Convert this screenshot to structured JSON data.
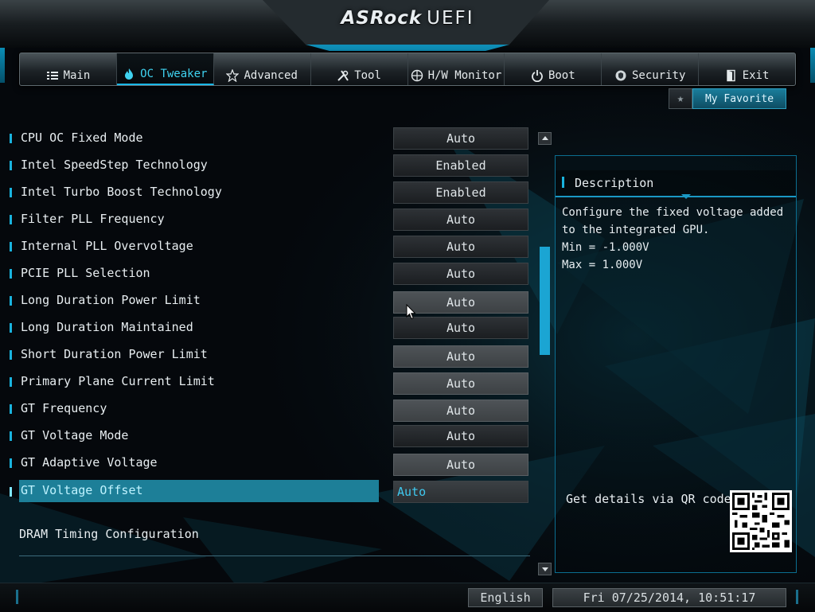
{
  "header": {
    "brand": "ASRock",
    "product": "UEFI"
  },
  "tabs": [
    {
      "label": "Main",
      "icon": "list-icon"
    },
    {
      "label": "OC Tweaker",
      "icon": "flame-icon",
      "active": true
    },
    {
      "label": "Advanced",
      "icon": "star-icon"
    },
    {
      "label": "Tool",
      "icon": "tools-icon"
    },
    {
      "label": "H/W Monitor",
      "icon": "monitor-icon"
    },
    {
      "label": "Boot",
      "icon": "power-icon"
    },
    {
      "label": "Security",
      "icon": "shield-icon"
    },
    {
      "label": "Exit",
      "icon": "exit-door-icon"
    }
  ],
  "favorite": {
    "label": "My Favorite",
    "star": "★"
  },
  "settings": [
    {
      "label": "CPU OC Fixed Mode",
      "value": "Auto"
    },
    {
      "label": "Intel SpeedStep Technology",
      "value": "Enabled"
    },
    {
      "label": "Intel Turbo Boost Technology",
      "value": "Enabled"
    },
    {
      "label": "Filter PLL Frequency",
      "value": "Auto"
    },
    {
      "label": "Internal PLL Overvoltage",
      "value": "Auto"
    },
    {
      "label": "PCIE PLL Selection",
      "value": "Auto"
    },
    {
      "label": "Long Duration Power Limit",
      "value": "Auto"
    },
    {
      "label": "Long Duration Maintained",
      "value": "Auto"
    },
    {
      "label": "Short Duration Power Limit",
      "value": "Auto"
    },
    {
      "label": "Primary Plane Current Limit",
      "value": "Auto"
    },
    {
      "label": "GT Frequency",
      "value": "Auto"
    },
    {
      "label": "GT Voltage Mode",
      "value": "Auto"
    },
    {
      "label": "GT Adaptive Voltage",
      "value": "Auto"
    },
    {
      "label": "GT Voltage Offset",
      "value": "Auto",
      "selected": true
    }
  ],
  "dram_config": "DRAM Timing Configuration",
  "description": {
    "title": "Description",
    "lines": [
      "Configure the fixed voltage added",
      "to the integrated GPU.",
      "Min = -1.000V",
      "Max = 1.000V"
    ]
  },
  "qr": {
    "text": "Get details via QR code"
  },
  "status": {
    "language": "English",
    "datetime": "Fri 07/25/2014, 10:51:17"
  },
  "colors": {
    "accent": "#19b3de",
    "selected_row": "#1d7f98",
    "background": "#05080c"
  }
}
